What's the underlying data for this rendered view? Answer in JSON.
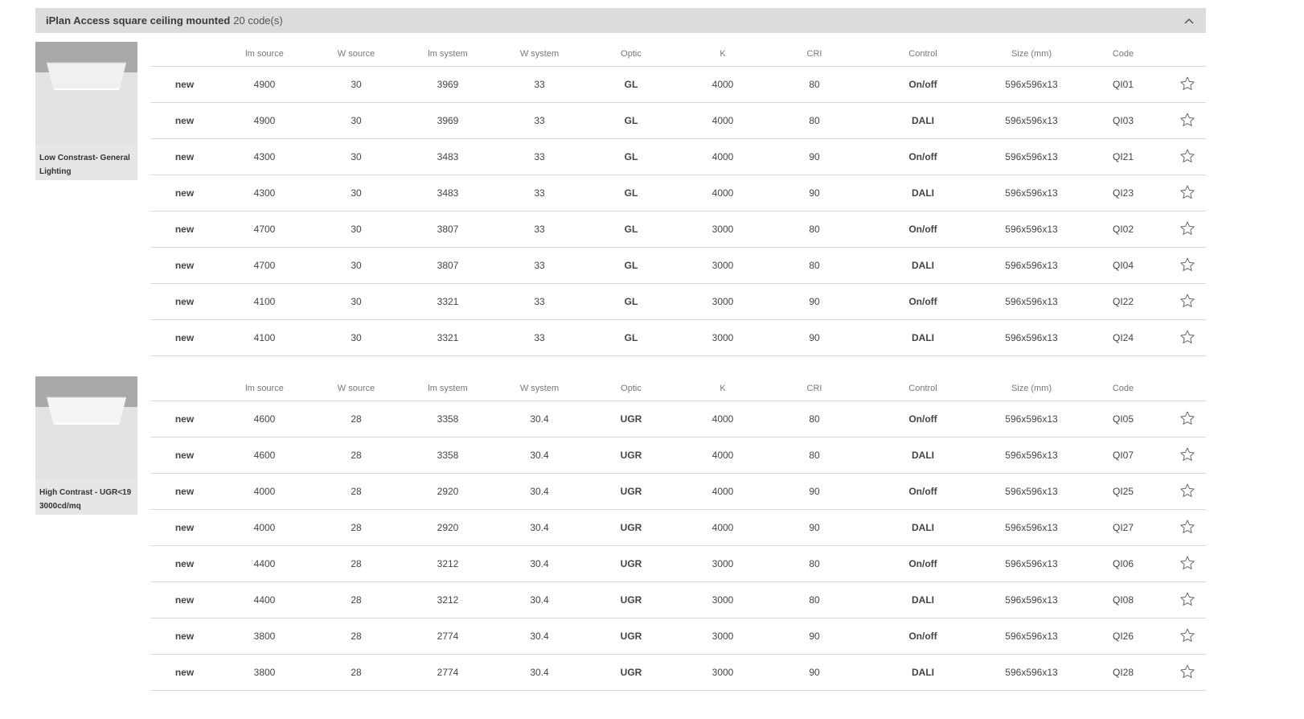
{
  "header": {
    "title": "iPlan Access square ceiling mounted",
    "count": "20 code(s)"
  },
  "colors": {
    "badge": "#c4003a",
    "header_bg": "#dcdcdc",
    "border": "#d8d8d8"
  },
  "icons": {
    "collapse": "chevron-up-icon",
    "favorite": "star-outline-icon"
  },
  "columns": [
    "",
    "lm source",
    "W source",
    "lm system",
    "W system",
    "Optic",
    "K",
    "CRI",
    "Control",
    "Size (mm)",
    "Code",
    ""
  ],
  "groups": [
    {
      "caption": [
        "Low Constrast- General",
        "Lighting"
      ],
      "rows": [
        {
          "badge": "new",
          "lm_source": "4900",
          "w_source": "30",
          "lm_system": "3969",
          "w_system": "33",
          "optic": "GL",
          "k": "4000",
          "cri": "80",
          "control": "On/off",
          "size": "596x596x13",
          "code": "QI01"
        },
        {
          "badge": "new",
          "lm_source": "4900",
          "w_source": "30",
          "lm_system": "3969",
          "w_system": "33",
          "optic": "GL",
          "k": "4000",
          "cri": "80",
          "control": "DALI",
          "size": "596x596x13",
          "code": "QI03"
        },
        {
          "badge": "new",
          "lm_source": "4300",
          "w_source": "30",
          "lm_system": "3483",
          "w_system": "33",
          "optic": "GL",
          "k": "4000",
          "cri": "90",
          "control": "On/off",
          "size": "596x596x13",
          "code": "QI21"
        },
        {
          "badge": "new",
          "lm_source": "4300",
          "w_source": "30",
          "lm_system": "3483",
          "w_system": "33",
          "optic": "GL",
          "k": "4000",
          "cri": "90",
          "control": "DALI",
          "size": "596x596x13",
          "code": "QI23"
        },
        {
          "badge": "new",
          "lm_source": "4700",
          "w_source": "30",
          "lm_system": "3807",
          "w_system": "33",
          "optic": "GL",
          "k": "3000",
          "cri": "80",
          "control": "On/off",
          "size": "596x596x13",
          "code": "QI02"
        },
        {
          "badge": "new",
          "lm_source": "4700",
          "w_source": "30",
          "lm_system": "3807",
          "w_system": "33",
          "optic": "GL",
          "k": "3000",
          "cri": "80",
          "control": "DALI",
          "size": "596x596x13",
          "code": "QI04"
        },
        {
          "badge": "new",
          "lm_source": "4100",
          "w_source": "30",
          "lm_system": "3321",
          "w_system": "33",
          "optic": "GL",
          "k": "3000",
          "cri": "90",
          "control": "On/off",
          "size": "596x596x13",
          "code": "QI22"
        },
        {
          "badge": "new",
          "lm_source": "4100",
          "w_source": "30",
          "lm_system": "3321",
          "w_system": "33",
          "optic": "GL",
          "k": "3000",
          "cri": "90",
          "control": "DALI",
          "size": "596x596x13",
          "code": "QI24"
        }
      ]
    },
    {
      "caption": [
        "High Contrast - UGR<19",
        "3000cd/mq"
      ],
      "rows": [
        {
          "badge": "new",
          "lm_source": "4600",
          "w_source": "28",
          "lm_system": "3358",
          "w_system": "30.4",
          "optic": "UGR",
          "k": "4000",
          "cri": "80",
          "control": "On/off",
          "size": "596x596x13",
          "code": "QI05"
        },
        {
          "badge": "new",
          "lm_source": "4600",
          "w_source": "28",
          "lm_system": "3358",
          "w_system": "30.4",
          "optic": "UGR",
          "k": "4000",
          "cri": "80",
          "control": "DALI",
          "size": "596x596x13",
          "code": "QI07"
        },
        {
          "badge": "new",
          "lm_source": "4000",
          "w_source": "28",
          "lm_system": "2920",
          "w_system": "30.4",
          "optic": "UGR",
          "k": "4000",
          "cri": "90",
          "control": "On/off",
          "size": "596x596x13",
          "code": "QI25"
        },
        {
          "badge": "new",
          "lm_source": "4000",
          "w_source": "28",
          "lm_system": "2920",
          "w_system": "30.4",
          "optic": "UGR",
          "k": "4000",
          "cri": "90",
          "control": "DALI",
          "size": "596x596x13",
          "code": "QI27"
        },
        {
          "badge": "new",
          "lm_source": "4400",
          "w_source": "28",
          "lm_system": "3212",
          "w_system": "30.4",
          "optic": "UGR",
          "k": "3000",
          "cri": "80",
          "control": "On/off",
          "size": "596x596x13",
          "code": "QI06"
        },
        {
          "badge": "new",
          "lm_source": "4400",
          "w_source": "28",
          "lm_system": "3212",
          "w_system": "30.4",
          "optic": "UGR",
          "k": "3000",
          "cri": "80",
          "control": "DALI",
          "size": "596x596x13",
          "code": "QI08"
        },
        {
          "badge": "new",
          "lm_source": "3800",
          "w_source": "28",
          "lm_system": "2774",
          "w_system": "30.4",
          "optic": "UGR",
          "k": "3000",
          "cri": "90",
          "control": "On/off",
          "size": "596x596x13",
          "code": "QI26"
        },
        {
          "badge": "new",
          "lm_source": "3800",
          "w_source": "28",
          "lm_system": "2774",
          "w_system": "30.4",
          "optic": "UGR",
          "k": "3000",
          "cri": "90",
          "control": "DALI",
          "size": "596x596x13",
          "code": "QI28"
        }
      ]
    }
  ]
}
